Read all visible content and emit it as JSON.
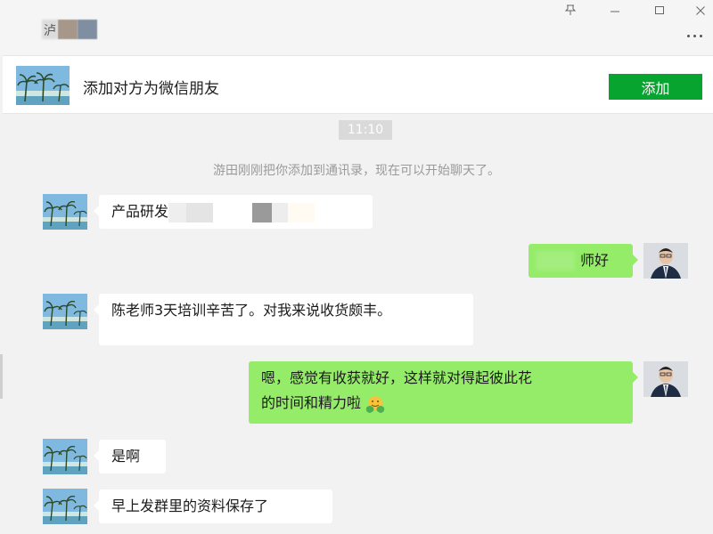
{
  "window": {
    "contact_name": "泸",
    "controls": {
      "pin_icon": "pin-icon",
      "minimize_icon": "minimize-icon",
      "maximize_icon": "maximize-icon",
      "close_icon": "close-icon",
      "more_icon": "more-icon"
    }
  },
  "add_friend_bar": {
    "prompt": "添加对方为微信朋友",
    "button_label": "添加"
  },
  "chat": {
    "time": "11:10",
    "system_message": "游田刚刚把你添加到通讯录，现在可以开始聊天了。",
    "messages": [
      {
        "side": "in",
        "text": "产品研发"
      },
      {
        "side": "out",
        "text": "师好"
      },
      {
        "side": "in",
        "text": "陈老师3天培训辛苦了。对我来说收货颇丰。"
      },
      {
        "side": "out",
        "text_line1": "嗯，感觉有收获就好，这样就对得起彼此花",
        "text_line2": "的时间和精力啦"
      },
      {
        "side": "in",
        "text": "是啊"
      },
      {
        "side": "in",
        "text": "早上发群里的资料保存了"
      }
    ]
  },
  "colors": {
    "chat_bg": "#f2f2f2",
    "outgoing_bubble": "#95ec69",
    "incoming_bubble": "#ffffff",
    "add_button": "#07a52f"
  }
}
